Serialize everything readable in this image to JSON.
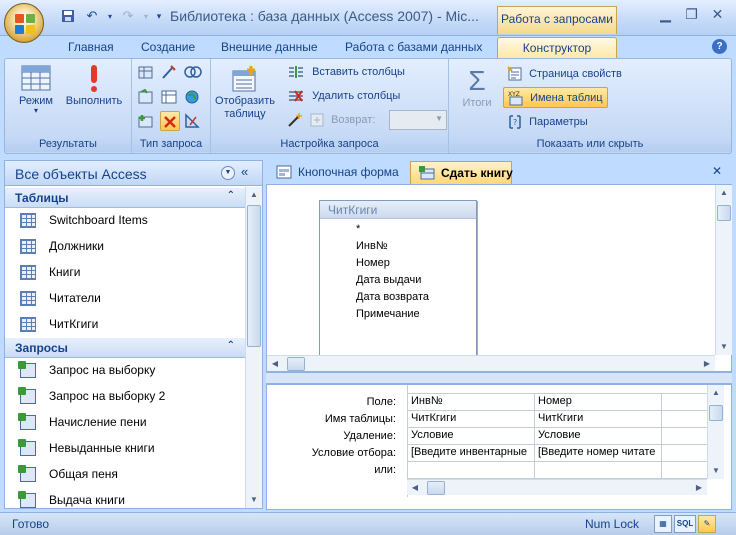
{
  "window": {
    "title": "Библиотека : база данных (Access 2007) - Mic...",
    "contextual_tab": "Работа с запросами"
  },
  "tabs": [
    "Главная",
    "Создание",
    "Внешние данные",
    "Работа с базами данных",
    "Конструктор"
  ],
  "ribbon": {
    "groups": {
      "results": {
        "label": "Результаты",
        "view": "Режим",
        "run": "Выполнить"
      },
      "query_type": {
        "label": "Тип запроса"
      },
      "setup": {
        "label": "Настройка запроса",
        "show_table": "Отобразить таблицу",
        "insert_columns": "Вставить столбцы",
        "delete_columns": "Удалить столбцы",
        "return_label": "Возврат:"
      },
      "show_hide": {
        "label": "Показать или скрыть",
        "totals": "Итоги",
        "property_sheet": "Страница свойств",
        "table_names": "Имена таблиц",
        "parameters": "Параметры"
      }
    }
  },
  "nav": {
    "title": "Все объекты Access",
    "sections": [
      {
        "title": "Таблицы",
        "items": [
          "Switchboard Items",
          "Должники",
          "Книги",
          "Читатели",
          "ЧитКгиги"
        ]
      },
      {
        "title": "Запросы",
        "items": [
          "Запрос на выборку",
          "Запрос на выборку 2",
          "Начисление пени",
          "Невыданные книги",
          "Общая пеня",
          "Выдача книги"
        ]
      }
    ]
  },
  "doc_tabs": [
    "Кнопочная форма",
    "Сдать книгу"
  ],
  "query_table": {
    "title": "ЧитКгиги",
    "fields": [
      "*",
      "Инв№",
      "Номер",
      "Дата выдачи",
      "Дата возврата",
      "Примечание"
    ]
  },
  "grid": {
    "row_labels": [
      "Поле:",
      "Имя таблицы:",
      "Удаление:",
      "Условие отбора:",
      "или:"
    ],
    "columns": [
      {
        "field": "Инв№",
        "table": "ЧитКгиги",
        "delete": "Условие",
        "criteria": "[Введите инвентарные"
      },
      {
        "field": "Номер",
        "table": "ЧитКгиги",
        "delete": "Условие",
        "criteria": "[Введите номер читате"
      }
    ]
  },
  "status": {
    "text": "Готово",
    "numlock": "Num Lock"
  },
  "colors": {
    "accent": "#15428b",
    "ribbon_bg": "#bfdbff",
    "active_tab": "#ffd776"
  }
}
